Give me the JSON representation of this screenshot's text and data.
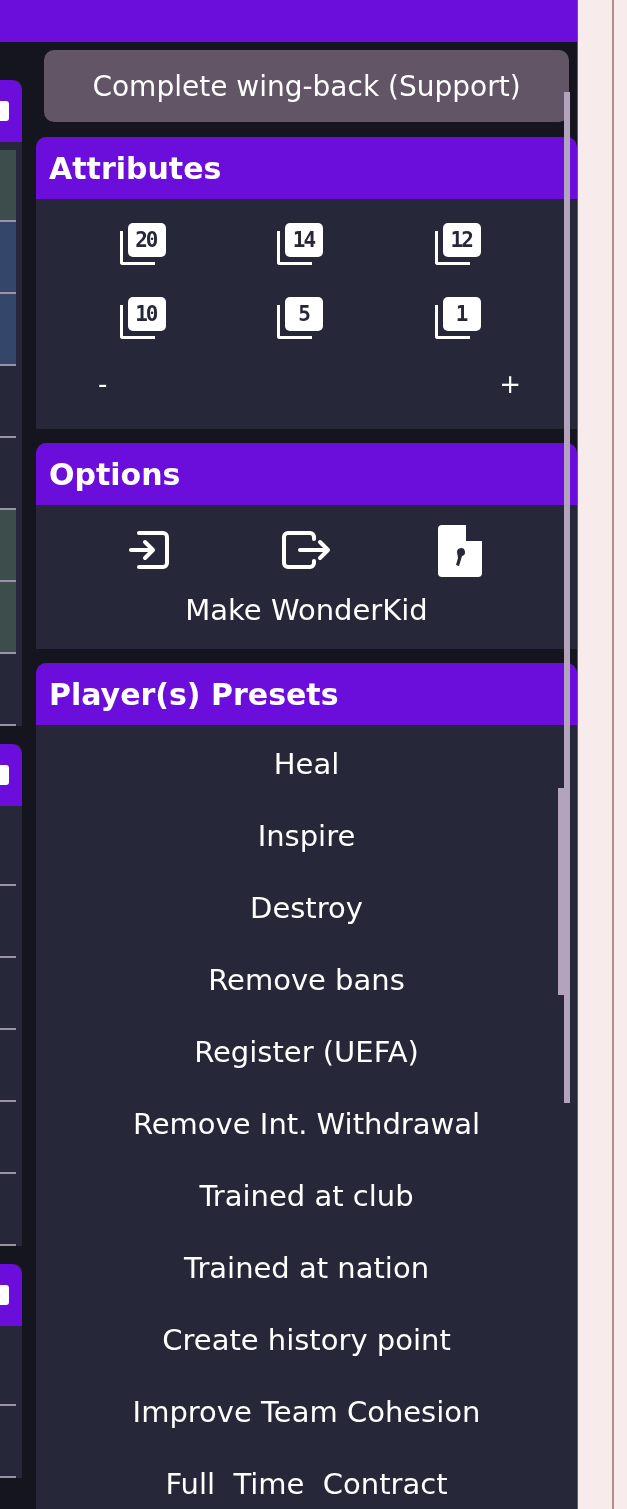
{
  "role_button": {
    "label": "Complete wing-back (Support)"
  },
  "attributes": {
    "title": "Attributes",
    "values": [
      "20",
      "14",
      "12",
      "10",
      "5",
      "1"
    ],
    "decrease": "-",
    "increase": "+"
  },
  "options": {
    "title": "Options",
    "actions": [
      {
        "kind": "import"
      },
      {
        "kind": "export"
      },
      {
        "kind": "csv"
      }
    ],
    "wonderkid": "Make WonderKid"
  },
  "presets": {
    "title": "Player(s) Presets",
    "items": [
      "Heal",
      "Inspire",
      "Destroy",
      "Remove bans",
      "Register (UEFA)",
      "Remove Int. Withdrawal",
      "Trained at club",
      "Trained at nation",
      "Create history point",
      "Improve Team Cohesion",
      "Full  Time  Contract"
    ]
  }
}
